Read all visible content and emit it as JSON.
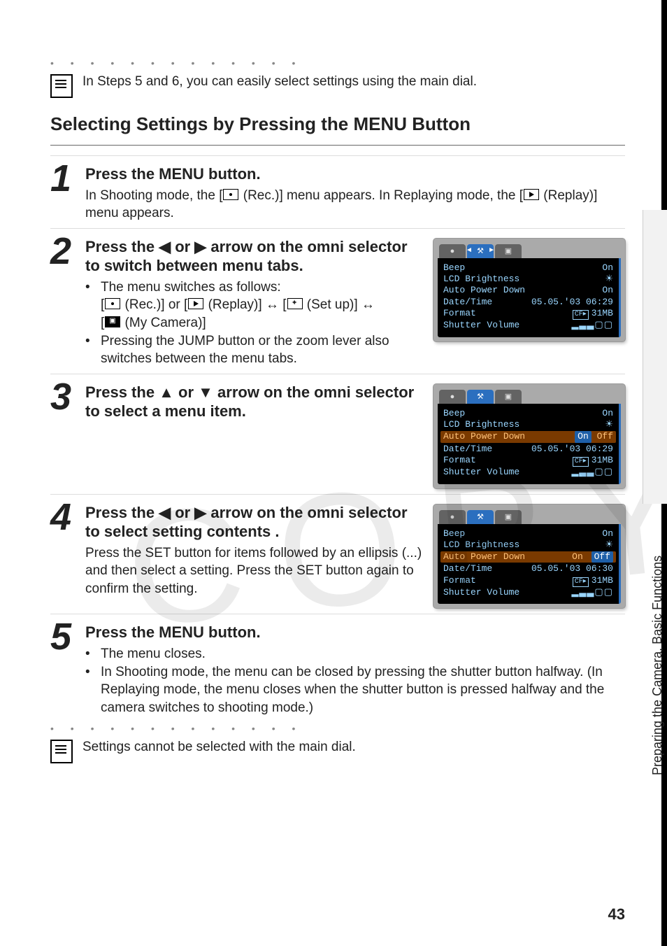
{
  "note_top": "In Steps 5 and 6, you can easily select settings using the main dial.",
  "section_title": "Selecting Settings by Pressing the MENU Button",
  "steps": {
    "s1": {
      "num": "1",
      "head": "Press the MENU button.",
      "body_a": "In Shooting mode, the [",
      "body_b": " (Rec.)] menu appears. In Replaying mode, the [",
      "body_c": " (Replay)] menu appears."
    },
    "s2": {
      "num": "2",
      "head": "Press the ◀ or ▶ arrow on the omni selector to switch between menu tabs.",
      "bullet1": "The menu switches as follows:",
      "seq_a": "[",
      "seq_b": " (Rec.)] or [",
      "seq_c": " (Replay)] ↔ [",
      "seq_d": " (Set up)] ↔",
      "seq_e": "[",
      "seq_f": " (My Camera)]",
      "bullet2": "Pressing the JUMP button or the zoom lever also switches between the menu tabs."
    },
    "s3": {
      "num": "3",
      "head": "Press the ▲ or ▼ arrow on the omni selector to select a menu item."
    },
    "s4": {
      "num": "4",
      "head": "Press the ◀ or ▶ arrow on the omni selector to select setting contents .",
      "body": "Press the SET button for items followed by an ellipsis (...) and then select a setting. Press the SET button again to confirm the setting."
    },
    "s5": {
      "num": "5",
      "head": "Press the MENU button.",
      "bullet1": "The menu closes.",
      "bullet2": "In Shooting mode, the menu can be closed by pressing the shutter button halfway. (In Replaying mode, the menu closes when the shutter button is pressed halfway and the camera switches to shooting mode.)"
    }
  },
  "note_bottom": "Settings cannot be selected with the main dial.",
  "screens": {
    "a": {
      "beep": {
        "label": "Beep",
        "value": "On"
      },
      "lcd": {
        "label": "LCD Brightness",
        "value": "☀"
      },
      "apd": {
        "label": "Auto Power Down",
        "value": "On"
      },
      "date": {
        "label": "Date/Time",
        "value": "05.05.'03 06:29"
      },
      "format": {
        "label": "Format",
        "cf": "CF▸",
        "value": "31MB"
      },
      "shutter": {
        "label": "Shutter Volume",
        "bars": "▂▃▃▢▢"
      }
    },
    "b": {
      "beep": {
        "label": "Beep",
        "value": "On"
      },
      "lcd": {
        "label": "LCD Brightness",
        "value": "☀"
      },
      "apd": {
        "label": "Auto Power Down",
        "on": "On",
        "off": "Off"
      },
      "date": {
        "label": "Date/Time",
        "value": "05.05.'03 06:29"
      },
      "format": {
        "label": "Format",
        "cf": "CF▸",
        "value": "31MB"
      },
      "shutter": {
        "label": "Shutter Volume",
        "bars": "▂▃▃▢▢"
      }
    },
    "c": {
      "beep": {
        "label": "Beep",
        "value": "On"
      },
      "lcd": {
        "label": "LCD Brightness",
        "value": "☀"
      },
      "apd": {
        "label": "Auto Power Down",
        "on": "On",
        "off": "Off"
      },
      "date": {
        "label": "Date/Time",
        "value": "05.05.'03 06:30"
      },
      "format": {
        "label": "Format",
        "cf": "CF▸",
        "value": "31MB"
      },
      "shutter": {
        "label": "Shutter Volume",
        "bars": "▂▃▃▢▢"
      }
    }
  },
  "side_label": "Preparing the Camera, Basic Functions",
  "page_number": "43",
  "watermark": "COPY",
  "icon_text": {
    "rec": "●",
    "play": "▶",
    "setup": "⚒",
    "my": "▣"
  }
}
